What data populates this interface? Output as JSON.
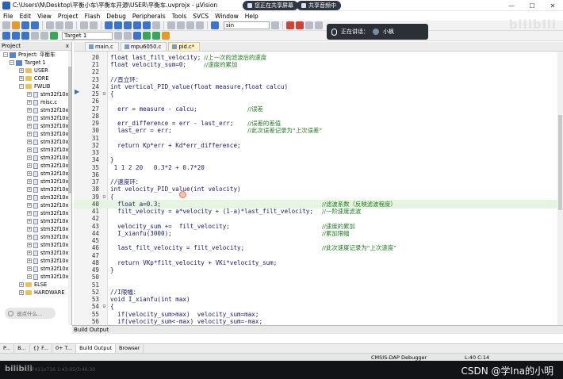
{
  "window": {
    "title": "C:\\Users\\N\\Desktop\\平衡小车\\平衡车开源\\USER\\平衡车.uvprojx - µVision",
    "share_screen": "您正在共享屏幕",
    "stop_share": "共享音频中",
    "min": "—",
    "max": "☐",
    "close": "✕"
  },
  "menu": [
    "File",
    "Edit",
    "View",
    "Project",
    "Flash",
    "Debug",
    "Peripherals",
    "Tools",
    "SVCS",
    "Window",
    "Help"
  ],
  "toolbar": {
    "target": "Target 1",
    "find_value": "sin"
  },
  "speaker_popup": {
    "label": "正在讲话：",
    "name": "小枫"
  },
  "watermark": "bilibili",
  "project": {
    "panel_title": "Project",
    "close": "x",
    "tree": [
      {
        "label": "Project: 平衡车",
        "kind": "root",
        "exp": "−",
        "indent": 4
      },
      {
        "label": "Target 1",
        "kind": "proj",
        "exp": "−",
        "indent": 12
      },
      {
        "label": "USER",
        "kind": "folder",
        "exp": "+",
        "indent": 24
      },
      {
        "label": "CORE",
        "kind": "folder",
        "exp": "+",
        "indent": 24
      },
      {
        "label": "FWLIB",
        "kind": "folder",
        "exp": "−",
        "indent": 24
      },
      {
        "label": "stm32f10x_",
        "kind": "file",
        "exp": "+",
        "indent": 34
      },
      {
        "label": "misc.c",
        "kind": "file",
        "exp": "+",
        "indent": 34
      },
      {
        "label": "stm32f10x_",
        "kind": "file",
        "exp": "+",
        "indent": 34
      },
      {
        "label": "stm32f10x_",
        "kind": "file",
        "exp": "+",
        "indent": 34
      },
      {
        "label": "stm32f10x_",
        "kind": "file",
        "exp": "+",
        "indent": 34
      },
      {
        "label": "stm32f10x_",
        "kind": "file",
        "exp": "+",
        "indent": 34
      },
      {
        "label": "stm32f10x_",
        "kind": "file",
        "exp": "+",
        "indent": 34
      },
      {
        "label": "stm32f10x_",
        "kind": "file",
        "exp": "+",
        "indent": 34
      },
      {
        "label": "stm32f10x_",
        "kind": "file",
        "exp": "+",
        "indent": 34
      },
      {
        "label": "stm32f10x_",
        "kind": "file",
        "exp": "+",
        "indent": 34
      },
      {
        "label": "stm32f10x_",
        "kind": "file",
        "exp": "+",
        "indent": 34
      },
      {
        "label": "stm32f10x_",
        "kind": "file",
        "exp": "+",
        "indent": 34
      },
      {
        "label": "stm32f10x_",
        "kind": "file",
        "exp": "+",
        "indent": 34
      },
      {
        "label": "stm32f10x_",
        "kind": "file",
        "exp": "+",
        "indent": 34
      },
      {
        "label": "stm32f10x_",
        "kind": "file",
        "exp": "+",
        "indent": 34
      },
      {
        "label": "stm32f10x_",
        "kind": "file",
        "exp": "+",
        "indent": 34
      },
      {
        "label": "stm32f10x_",
        "kind": "file",
        "exp": "+",
        "indent": 34
      },
      {
        "label": "stm32f10x_",
        "kind": "file",
        "exp": "+",
        "indent": 34
      },
      {
        "label": "stm32f10x_",
        "kind": "file",
        "exp": "+",
        "indent": 34
      },
      {
        "label": "stm32f10x_",
        "kind": "file",
        "exp": "+",
        "indent": 34
      },
      {
        "label": "stm32f10x_",
        "kind": "file",
        "exp": "+",
        "indent": 34
      },
      {
        "label": "stm32f10x_",
        "kind": "file",
        "exp": "+",
        "indent": 34
      },
      {
        "label": "stm32f10x_",
        "kind": "file",
        "exp": "+",
        "indent": 34
      },
      {
        "label": "stm32f10x_",
        "kind": "file",
        "exp": "+",
        "indent": 34
      },
      {
        "label": "ELSE",
        "kind": "folder",
        "exp": "+",
        "indent": 24
      },
      {
        "label": "HARDWARE",
        "kind": "folder",
        "exp": "+",
        "indent": 24
      }
    ]
  },
  "comment_bubble": "说点什么...",
  "tabs": [
    {
      "label": "main.c",
      "active": false
    },
    {
      "label": "mpu6050.c",
      "active": false
    },
    {
      "label": "pid.c*",
      "active": true
    }
  ],
  "code": [
    {
      "n": "20",
      "fold": "",
      "code": "float last_filt_velocity;",
      "cmt": "//上一次的滤波后的速度",
      "near": true
    },
    {
      "n": "21",
      "fold": "",
      "code": "float velocity_sum=0;    ",
      "cmt": "//速度的累加",
      "near": true
    },
    {
      "n": "22",
      "fold": "",
      "code": "",
      "cmt": ""
    },
    {
      "n": "23",
      "fold": "",
      "code": "//直立环：",
      "cmt": ""
    },
    {
      "n": "24",
      "fold": "",
      "code": "int vertical_PID_value(float measure,float calcu)",
      "cmt": ""
    },
    {
      "n": "25",
      "fold": "⊟",
      "code": "{",
      "cmt": ""
    },
    {
      "n": "26",
      "fold": "",
      "code": "",
      "cmt": ""
    },
    {
      "n": "27",
      "fold": "",
      "code": "  err = measure - calcu;             ",
      "cmt": "//误差",
      "near": true
    },
    {
      "n": "28",
      "fold": "",
      "code": "",
      "cmt": ""
    },
    {
      "n": "29",
      "fold": "",
      "code": "  err_difference = err - last_err;   ",
      "cmt": "//误差的差值",
      "near": true
    },
    {
      "n": "30",
      "fold": "",
      "code": "  last_err = err;                    ",
      "cmt": "//此次误差记录为“上次误差”",
      "near": true
    },
    {
      "n": "31",
      "fold": "",
      "code": "",
      "cmt": ""
    },
    {
      "n": "32",
      "fold": "",
      "code": "  return Kp*err + Kd*err_difference;",
      "cmt": ""
    },
    {
      "n": "33",
      "fold": "",
      "code": "",
      "cmt": ""
    },
    {
      "n": "34",
      "fold": "",
      "code": "}",
      "cmt": ""
    },
    {
      "n": "35",
      "fold": "",
      "code": " 1 1 2 20   0.3*2 + 0.7*20",
      "cmt": ""
    },
    {
      "n": "36",
      "fold": "",
      "code": "",
      "cmt": ""
    },
    {
      "n": "37",
      "fold": "",
      "code": "//速度环：",
      "cmt": ""
    },
    {
      "n": "38",
      "fold": "",
      "code": "int velocity_PID_value(int velocity)",
      "cmt": ""
    },
    {
      "n": "39",
      "fold": "⊟",
      "code": "{",
      "cmt": ""
    },
    {
      "n": "40",
      "fold": "",
      "code": "  float a=0.3;",
      "cmt": "//滤波系数（反映滤波程度）",
      "hl": true
    },
    {
      "n": "41",
      "fold": "",
      "code": "  filt_velocity = a*velocity + (1-a)*last_filt_velocity;",
      "cmt": "//一阶速度滤波"
    },
    {
      "n": "42",
      "fold": "",
      "code": "",
      "cmt": ""
    },
    {
      "n": "43",
      "fold": "",
      "code": "  velocity_sum +=  filt_velocity;",
      "cmt": "//速度的累加"
    },
    {
      "n": "44",
      "fold": "",
      "code": "  I_xianfu(3000);",
      "cmt": "//累加限幅"
    },
    {
      "n": "45",
      "fold": "",
      "code": "",
      "cmt": ""
    },
    {
      "n": "46",
      "fold": "",
      "code": "  last_filt_velocity = filt_velocity;",
      "cmt": "//此次速度记录为“上次速度”"
    },
    {
      "n": "47",
      "fold": "",
      "code": "",
      "cmt": ""
    },
    {
      "n": "48",
      "fold": "",
      "code": "  return VKp*filt_velocity + VKi*velocity_sum;",
      "cmt": ""
    },
    {
      "n": "49",
      "fold": "",
      "code": "}",
      "cmt": ""
    },
    {
      "n": "50",
      "fold": "",
      "code": "",
      "cmt": ""
    },
    {
      "n": "51",
      "fold": "",
      "code": "",
      "cmt": ""
    },
    {
      "n": "52",
      "fold": "",
      "code": "//I限幅：",
      "cmt": ""
    },
    {
      "n": "53",
      "fold": "",
      "code": "void I_xianfu(int max)",
      "cmt": ""
    },
    {
      "n": "54",
      "fold": "⊟",
      "code": "{",
      "cmt": ""
    },
    {
      "n": "55",
      "fold": "",
      "code": "  if(velocity_sum>max)  velocity_sum=max;",
      "cmt": ""
    },
    {
      "n": "56",
      "fold": "",
      "code": "  if(velocity_sum<-max) velocity_sum=-max;",
      "cmt": ""
    }
  ],
  "build_output": {
    "title": "Build Output"
  },
  "bottom_tabs": [
    "P...",
    "B...",
    "{} F...",
    "0+ T...",
    "Build Output",
    "Browser"
  ],
  "status": {
    "debugger": "CMSIS-DAP Debugger",
    "position": "L:40 C:14"
  },
  "video": {
    "logo": "bilibili",
    "time": "1/P411x716 1:43:05/3:46:30",
    "credit": "CSDN @学Ina的小明"
  }
}
